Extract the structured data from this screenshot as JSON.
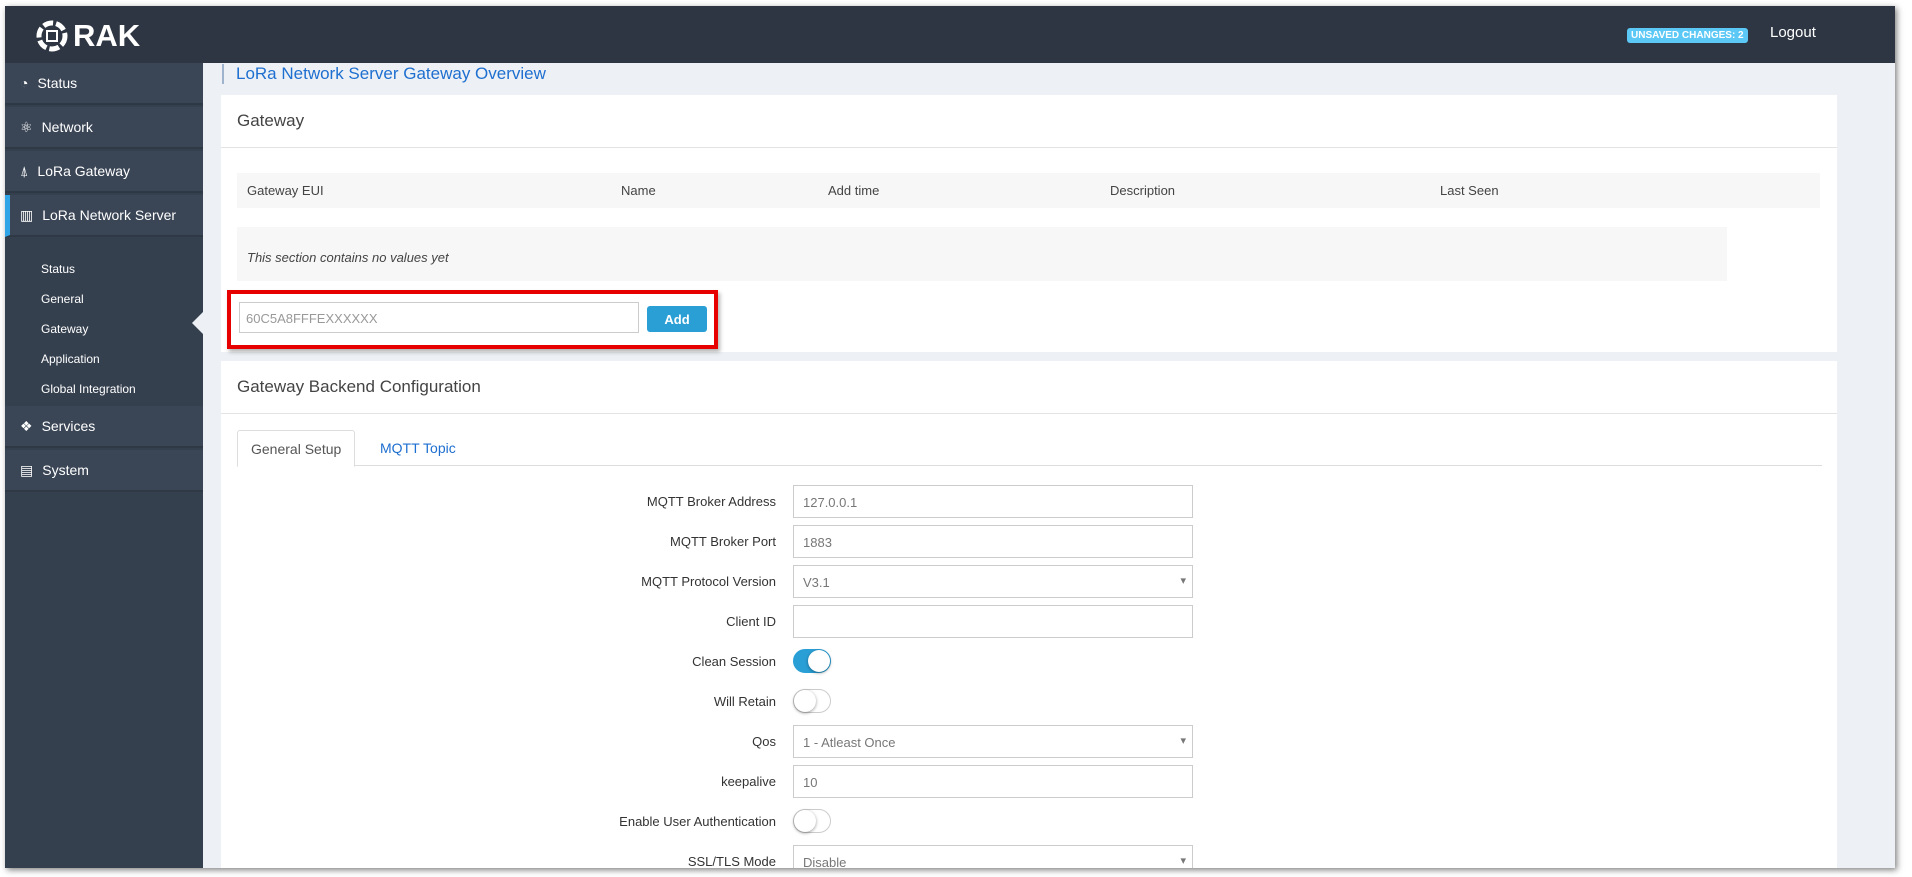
{
  "header": {
    "brand": "RAK",
    "unsaved_badge": "UNSAVED CHANGES: 2",
    "logout": "Logout"
  },
  "sidebar": {
    "items": [
      {
        "label": "Status",
        "icon": "gauge-icon"
      },
      {
        "label": "Network",
        "icon": "network-icon"
      },
      {
        "label": "LoRa Gateway",
        "icon": "antenna-icon"
      },
      {
        "label": "LoRa Network Server",
        "icon": "bar-chart-icon"
      },
      {
        "label": "Services",
        "icon": "cubes-icon"
      },
      {
        "label": "System",
        "icon": "server-icon"
      }
    ],
    "subitems": [
      "Status",
      "General",
      "Gateway",
      "Application",
      "Global Integration"
    ],
    "active_subitem": "Gateway"
  },
  "page": {
    "title": "LoRa Network Server Gateway Overview"
  },
  "gateway": {
    "title": "Gateway",
    "columns": [
      "Gateway EUI",
      "Name",
      "Add time",
      "Description",
      "Last Seen"
    ],
    "empty_text": "This section contains no values yet",
    "eui_value": "60C5A8FFFEXXXXXX",
    "add_label": "Add"
  },
  "backend": {
    "title": "Gateway Backend Configuration",
    "tabs": [
      "General Setup",
      "MQTT Topic"
    ],
    "fields": {
      "broker_address": {
        "label": "MQTT Broker Address",
        "value": "127.0.0.1"
      },
      "broker_port": {
        "label": "MQTT Broker Port",
        "value": "1883"
      },
      "protocol": {
        "label": "MQTT Protocol Version",
        "value": "V3.1"
      },
      "client_id": {
        "label": "Client ID",
        "value": ""
      },
      "clean_session": {
        "label": "Clean Session",
        "on": true
      },
      "will_retain": {
        "label": "Will Retain",
        "on": false
      },
      "qos": {
        "label": "Qos",
        "value": "1 - Atleast Once"
      },
      "keepalive": {
        "label": "keepalive",
        "value": "10"
      },
      "user_auth": {
        "label": "Enable User Authentication",
        "on": false
      },
      "ssl": {
        "label": "SSL/TLS Mode",
        "value": "Disable"
      }
    }
  },
  "colors": {
    "header": "#2e3643",
    "sidebar": "#35404f",
    "accent": "#2a9fd6",
    "highlight": "#e60000"
  }
}
